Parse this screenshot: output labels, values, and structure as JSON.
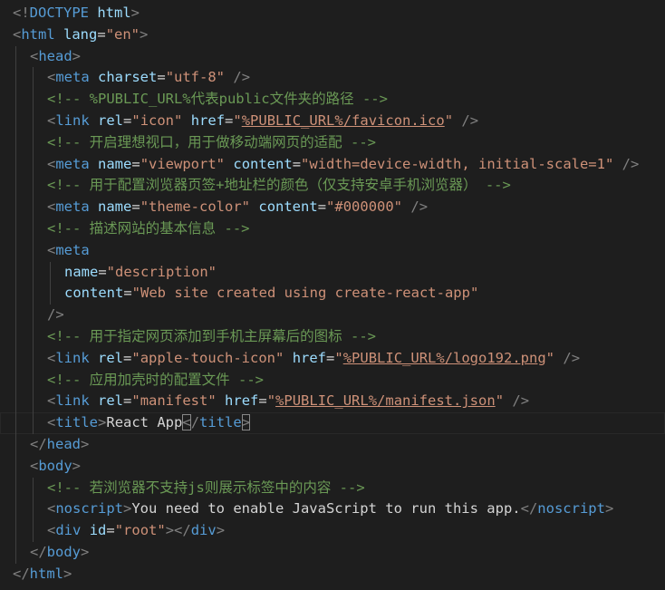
{
  "editor": {
    "language": "html",
    "current_line": 20,
    "colors": {
      "background": "#1e1e1e",
      "tag": "#569cd6",
      "attribute": "#9cdcfe",
      "string": "#ce9178",
      "comment": "#6a9955",
      "text": "#d4d4d4",
      "punctuation": "#808080"
    },
    "lines": [
      {
        "indent": 0,
        "tokens": [
          [
            "punc",
            "<!"
          ],
          [
            "kw",
            "DOCTYPE"
          ],
          [
            "txt",
            " "
          ],
          [
            "attr",
            "html"
          ],
          [
            "punc",
            ">"
          ]
        ]
      },
      {
        "indent": 0,
        "tokens": [
          [
            "punc",
            "<"
          ],
          [
            "tag",
            "html"
          ],
          [
            "txt",
            " "
          ],
          [
            "attr",
            "lang"
          ],
          [
            "txt",
            "="
          ],
          [
            "str",
            "\"en\""
          ],
          [
            "punc",
            ">"
          ]
        ]
      },
      {
        "indent": 1,
        "tokens": [
          [
            "punc",
            "<"
          ],
          [
            "tag",
            "head"
          ],
          [
            "punc",
            ">"
          ]
        ]
      },
      {
        "indent": 2,
        "tokens": [
          [
            "punc",
            "<"
          ],
          [
            "tag",
            "meta"
          ],
          [
            "txt",
            " "
          ],
          [
            "attr",
            "charset"
          ],
          [
            "txt",
            "="
          ],
          [
            "str",
            "\"utf-8\""
          ],
          [
            "txt",
            " "
          ],
          [
            "punc",
            "/>"
          ]
        ]
      },
      {
        "indent": 2,
        "tokens": [
          [
            "cmt",
            "<!-- %PUBLIC_URL%代表public文件夹的路径 -->"
          ]
        ]
      },
      {
        "indent": 2,
        "tokens": [
          [
            "punc",
            "<"
          ],
          [
            "tag",
            "link"
          ],
          [
            "txt",
            " "
          ],
          [
            "attr",
            "rel"
          ],
          [
            "txt",
            "="
          ],
          [
            "str",
            "\"icon\""
          ],
          [
            "txt",
            " "
          ],
          [
            "attr",
            "href"
          ],
          [
            "txt",
            "="
          ],
          [
            "str",
            "\""
          ],
          [
            "link",
            "%PUBLIC_URL%/favicon.ico"
          ],
          [
            "str",
            "\""
          ],
          [
            "txt",
            " "
          ],
          [
            "punc",
            "/>"
          ]
        ]
      },
      {
        "indent": 2,
        "tokens": [
          [
            "cmt",
            "<!-- 开启理想视口，用于做移动端网页的适配 -->"
          ]
        ]
      },
      {
        "indent": 2,
        "tokens": [
          [
            "punc",
            "<"
          ],
          [
            "tag",
            "meta"
          ],
          [
            "txt",
            " "
          ],
          [
            "attr",
            "name"
          ],
          [
            "txt",
            "="
          ],
          [
            "str",
            "\"viewport\""
          ],
          [
            "txt",
            " "
          ],
          [
            "attr",
            "content"
          ],
          [
            "txt",
            "="
          ],
          [
            "str",
            "\"width=device-width, initial-scale=1\""
          ],
          [
            "txt",
            " "
          ],
          [
            "punc",
            "/>"
          ]
        ]
      },
      {
        "indent": 2,
        "tokens": [
          [
            "cmt",
            "<!-- 用于配置浏览器页签+地址栏的颜色（仅支持安卓手机浏览器） -->"
          ]
        ]
      },
      {
        "indent": 2,
        "tokens": [
          [
            "punc",
            "<"
          ],
          [
            "tag",
            "meta"
          ],
          [
            "txt",
            " "
          ],
          [
            "attr",
            "name"
          ],
          [
            "txt",
            "="
          ],
          [
            "str",
            "\"theme-color\""
          ],
          [
            "txt",
            " "
          ],
          [
            "attr",
            "content"
          ],
          [
            "txt",
            "="
          ],
          [
            "str",
            "\"#000000\""
          ],
          [
            "txt",
            " "
          ],
          [
            "punc",
            "/>"
          ]
        ]
      },
      {
        "indent": 2,
        "tokens": [
          [
            "cmt",
            "<!-- 描述网站的基本信息 -->"
          ]
        ]
      },
      {
        "indent": 2,
        "tokens": [
          [
            "punc",
            "<"
          ],
          [
            "tag",
            "meta"
          ]
        ]
      },
      {
        "indent": 3,
        "tokens": [
          [
            "attr",
            "name"
          ],
          [
            "txt",
            "="
          ],
          [
            "str",
            "\"description\""
          ]
        ]
      },
      {
        "indent": 3,
        "tokens": [
          [
            "attr",
            "content"
          ],
          [
            "txt",
            "="
          ],
          [
            "str",
            "\"Web site created using create-react-app\""
          ]
        ]
      },
      {
        "indent": 2,
        "tokens": [
          [
            "punc",
            "/>"
          ]
        ]
      },
      {
        "indent": 2,
        "tokens": [
          [
            "cmt",
            "<!-- 用于指定网页添加到手机主屏幕后的图标 -->"
          ]
        ]
      },
      {
        "indent": 2,
        "tokens": [
          [
            "punc",
            "<"
          ],
          [
            "tag",
            "link"
          ],
          [
            "txt",
            " "
          ],
          [
            "attr",
            "rel"
          ],
          [
            "txt",
            "="
          ],
          [
            "str",
            "\"apple-touch-icon\""
          ],
          [
            "txt",
            " "
          ],
          [
            "attr",
            "href"
          ],
          [
            "txt",
            "="
          ],
          [
            "str",
            "\""
          ],
          [
            "link",
            "%PUBLIC_URL%/logo192.png"
          ],
          [
            "str",
            "\""
          ],
          [
            "txt",
            " "
          ],
          [
            "punc",
            "/>"
          ]
        ]
      },
      {
        "indent": 2,
        "tokens": [
          [
            "cmt",
            "<!-- 应用加壳时的配置文件 -->"
          ]
        ]
      },
      {
        "indent": 2,
        "tokens": [
          [
            "punc",
            "<"
          ],
          [
            "tag",
            "link"
          ],
          [
            "txt",
            " "
          ],
          [
            "attr",
            "rel"
          ],
          [
            "txt",
            "="
          ],
          [
            "str",
            "\"manifest\""
          ],
          [
            "txt",
            " "
          ],
          [
            "attr",
            "href"
          ],
          [
            "txt",
            "="
          ],
          [
            "str",
            "\""
          ],
          [
            "link",
            "%PUBLIC_URL%/manifest.json"
          ],
          [
            "str",
            "\""
          ],
          [
            "txt",
            " "
          ],
          [
            "punc",
            "/>"
          ]
        ]
      },
      {
        "indent": 2,
        "tokens": [
          [
            "punc",
            "<"
          ],
          [
            "tag",
            "title"
          ],
          [
            "punc",
            ">"
          ],
          [
            "txt",
            "React App"
          ],
          [
            "cursor",
            ""
          ],
          [
            "match",
            "<"
          ],
          [
            "punc",
            "/"
          ],
          [
            "tag",
            "title"
          ],
          [
            "match",
            ">"
          ]
        ]
      },
      {
        "indent": 1,
        "tokens": [
          [
            "punc",
            "</"
          ],
          [
            "tag",
            "head"
          ],
          [
            "punc",
            ">"
          ]
        ]
      },
      {
        "indent": 1,
        "tokens": [
          [
            "punc",
            "<"
          ],
          [
            "tag",
            "body"
          ],
          [
            "punc",
            ">"
          ]
        ]
      },
      {
        "indent": 2,
        "tokens": [
          [
            "cmt",
            "<!-- 若浏览器不支持js则展示标签中的内容 -->"
          ]
        ]
      },
      {
        "indent": 2,
        "tokens": [
          [
            "punc",
            "<"
          ],
          [
            "tag",
            "noscript"
          ],
          [
            "punc",
            ">"
          ],
          [
            "txt",
            "You need to enable JavaScript to run this app."
          ],
          [
            "punc",
            "</"
          ],
          [
            "tag",
            "noscript"
          ],
          [
            "punc",
            ">"
          ]
        ]
      },
      {
        "indent": 2,
        "tokens": [
          [
            "punc",
            "<"
          ],
          [
            "tag",
            "div"
          ],
          [
            "txt",
            " "
          ],
          [
            "attr",
            "id"
          ],
          [
            "txt",
            "="
          ],
          [
            "str",
            "\"root\""
          ],
          [
            "punc",
            "></"
          ],
          [
            "tag",
            "div"
          ],
          [
            "punc",
            ">"
          ]
        ]
      },
      {
        "indent": 1,
        "tokens": [
          [
            "punc",
            "</"
          ],
          [
            "tag",
            "body"
          ],
          [
            "punc",
            ">"
          ]
        ]
      },
      {
        "indent": 0,
        "tokens": [
          [
            "punc",
            "</"
          ],
          [
            "tag",
            "html"
          ],
          [
            "punc",
            ">"
          ]
        ]
      }
    ]
  }
}
